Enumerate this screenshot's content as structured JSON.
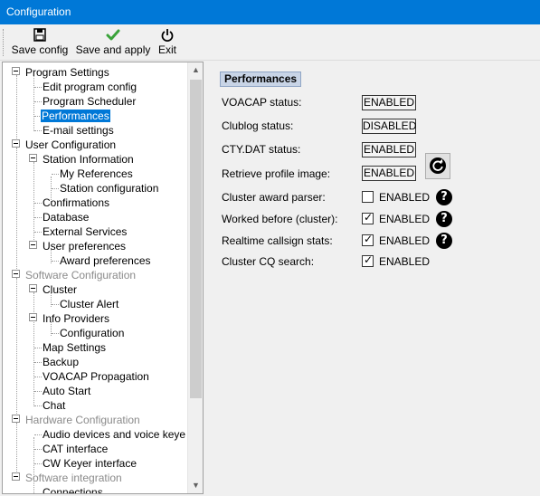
{
  "window": {
    "title": "Configuration"
  },
  "toolbar": {
    "save_config": "Save config",
    "save_and_apply": "Save and apply",
    "exit": "Exit"
  },
  "tree": {
    "nodes": [
      {
        "label": "Program Settings"
      },
      {
        "label": "Edit program config"
      },
      {
        "label": "Program Scheduler"
      },
      {
        "label": "Performances"
      },
      {
        "label": "E-mail settings"
      },
      {
        "label": "User Configuration"
      },
      {
        "label": "Station Information"
      },
      {
        "label": "My References"
      },
      {
        "label": "Station configuration"
      },
      {
        "label": "Confirmations"
      },
      {
        "label": "Database"
      },
      {
        "label": "External Services"
      },
      {
        "label": "User preferences"
      },
      {
        "label": "Award preferences"
      },
      {
        "label": "Software Configuration"
      },
      {
        "label": "Cluster"
      },
      {
        "label": "Cluster Alert"
      },
      {
        "label": "Info Providers"
      },
      {
        "label": "Configuration"
      },
      {
        "label": "Map Settings"
      },
      {
        "label": "Backup"
      },
      {
        "label": "VOACAP Propagation"
      },
      {
        "label": "Auto Start"
      },
      {
        "label": "Chat"
      },
      {
        "label": "Hardware Configuration"
      },
      {
        "label": "Audio devices and voice keye"
      },
      {
        "label": "CAT interface"
      },
      {
        "label": "CW Keyer interface"
      },
      {
        "label": "Software integration"
      },
      {
        "label": "Connections"
      }
    ],
    "selected": "Performances"
  },
  "panel": {
    "title": "Performances",
    "rows": [
      {
        "label": "VOACAP status:",
        "value": "ENABLED"
      },
      {
        "label": "Clublog status:",
        "value": "DISABLED"
      },
      {
        "label": "CTY.DAT status:",
        "value": "ENABLED"
      },
      {
        "label": "Retrieve profile image:",
        "value": "ENABLED"
      }
    ],
    "checkboxes": [
      {
        "label": "Cluster award parser:",
        "text": "ENABLED",
        "checked": false
      },
      {
        "label": "Worked before (cluster):",
        "text": "ENABLED",
        "checked": true
      },
      {
        "label": "Realtime callsign stats:",
        "text": "ENABLED",
        "checked": true
      },
      {
        "label": "Cluster CQ search:",
        "text": "ENABLED",
        "checked": true
      }
    ],
    "help_glyph": "?"
  },
  "colors": {
    "titlebar": "#0078d7",
    "selection": "#0078d7",
    "section_header": "#c8d4e6"
  }
}
